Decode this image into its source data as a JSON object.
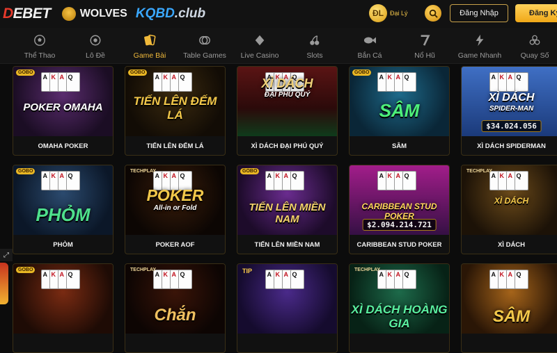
{
  "header": {
    "logo_main": "DEBET",
    "logo_partner1": "WOLVES",
    "logo_partner2_a": "KQBD",
    "logo_partner2_b": ".club",
    "agent_label": "Đại Lý",
    "agent_icon_text": "ĐL",
    "login_label": "Đăng Nhập",
    "register_label": "Đăng Ký"
  },
  "nav": {
    "items": [
      {
        "label": "Thể Thao",
        "icon": "soccer-ball-icon"
      },
      {
        "label": "Lô Đề",
        "icon": "lottery-icon"
      },
      {
        "label": "Game Bài",
        "icon": "cards-icon"
      },
      {
        "label": "Table Games",
        "icon": "chips-icon"
      },
      {
        "label": "Live Casino",
        "icon": "diamond-icon"
      },
      {
        "label": "Slots",
        "icon": "cherry-icon"
      },
      {
        "label": "Bắn Cá",
        "icon": "fish-icon"
      },
      {
        "label": "Nổ Hũ",
        "icon": "seven-icon"
      },
      {
        "label": "Game Nhanh",
        "icon": "lightning-icon"
      },
      {
        "label": "Quay Số",
        "icon": "balls-icon"
      }
    ],
    "active_index": 2
  },
  "games": [
    {
      "name": "OMAHA POKER",
      "thumb_title": "POKER OMAHA",
      "tag": "GOBO"
    },
    {
      "name": "TIẾN LÊN ĐẾM LÁ",
      "thumb_title": "TIẾN LÊN ĐẾM LÁ",
      "tag": "GOBO"
    },
    {
      "name": "XÌ DÁCH ĐẠI PHÚ QUÝ",
      "thumb_title": "XÌ DÁCH",
      "thumb_subtitle": "ĐẠI PHÚ QUÝ",
      "tag": ""
    },
    {
      "name": "SÂM",
      "thumb_title": "SÂM",
      "tag": "GOBO"
    },
    {
      "name": "XÌ DÁCH SPIDERMAN",
      "thumb_title": "XÌ DÁCH",
      "thumb_subtitle": "SPIDER-MAN",
      "jackpot": "$34.024.056",
      "tag": ""
    },
    {
      "name": "PHỎM",
      "thumb_title": "PHỎM",
      "tag": "GOBO"
    },
    {
      "name": "POKER AOF",
      "thumb_title": "POKER",
      "thumb_subtitle": "All-in or Fold",
      "tag": "TECHPLAY"
    },
    {
      "name": "TIẾN LÊN MIỀN NAM",
      "thumb_title": "TIẾN LÊN MIỀN NAM",
      "tag": "GOBO"
    },
    {
      "name": "CARIBBEAN STUD POKER",
      "thumb_title": "CARIBBEAN STUD POKER",
      "jackpot": "$2.094.214.721",
      "tag": ""
    },
    {
      "name": "XÌ DÁCH",
      "thumb_title": "XÌ DÁCH",
      "tag": "TECHPLAY"
    },
    {
      "name": "",
      "thumb_title": "",
      "tag": "GOBO"
    },
    {
      "name": "",
      "thumb_title": "Chắn",
      "tag": "TECHPLAY"
    },
    {
      "name": "",
      "thumb_title": "",
      "tag": "TIP"
    },
    {
      "name": "",
      "thumb_title": "XÌ DÁCH HOÀNG GIA",
      "tag": "TECHPLAY"
    },
    {
      "name": "",
      "thumb_title": "SÂM",
      "tag": ""
    }
  ],
  "colors": {
    "accent": "#f0b93a",
    "background": "#0c0c0c",
    "card_border": "#3a2f16"
  }
}
